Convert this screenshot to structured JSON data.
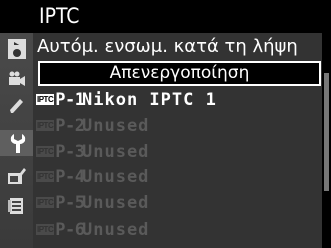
{
  "header": {
    "title": "IPTC"
  },
  "tabs": [
    {
      "name": "playback-menu",
      "icon": "play-icon"
    },
    {
      "name": "shooting-menu",
      "icon": "camera-icon"
    },
    {
      "name": "movie-menu",
      "icon": "movie-camera-icon"
    },
    {
      "name": "custom-settings-menu",
      "icon": "pencil-icon"
    },
    {
      "name": "setup-menu",
      "icon": "wrench-icon",
      "active": true
    },
    {
      "name": "retouch-menu",
      "icon": "retouch-brush-icon"
    },
    {
      "name": "my-menu",
      "icon": "my-menu-list-icon"
    }
  ],
  "panel": {
    "subtitle": "Αυτόμ. ενσωμ. κατά τη λήψη",
    "selected_option": "Απενεργοποίηση"
  },
  "presets": [
    {
      "badge": "IPTC",
      "slot": "P-1",
      "name": "Nikon IPTC 1",
      "state": "active"
    },
    {
      "badge": "IPTC",
      "slot": "P-2",
      "name": "Unused",
      "state": "dim"
    },
    {
      "badge": "IPTC",
      "slot": "P-3",
      "name": "Unused",
      "state": "dim"
    },
    {
      "badge": "IPTC",
      "slot": "P-4",
      "name": "Unused",
      "state": "dim"
    },
    {
      "badge": "IPTC",
      "slot": "P-5",
      "name": "Unused",
      "state": "dim"
    },
    {
      "badge": "IPTC",
      "slot": "P-6",
      "name": "Unused",
      "state": "dim"
    }
  ],
  "colors": {
    "background": "#000000",
    "panel": "#333333",
    "tabbar": "#444444",
    "active_tab": "#5f5f5f",
    "text": "#ffffff",
    "dim_text": "#5a5a5a"
  }
}
